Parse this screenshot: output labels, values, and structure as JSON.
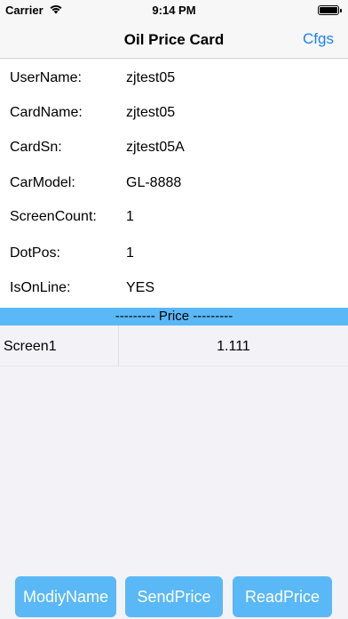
{
  "status": {
    "carrier": "Carrier",
    "time": "9:14 PM"
  },
  "nav": {
    "title": "Oil Price Card",
    "right_button": "Cfgs"
  },
  "info": [
    {
      "label": "UserName:",
      "value": "zjtest05"
    },
    {
      "label": "CardName:",
      "value": "zjtest05"
    },
    {
      "label": "CardSn:",
      "value": "zjtest05A"
    },
    {
      "label": "CarModel:",
      "value": "GL-8888"
    },
    {
      "label": "ScreenCount:",
      "value": "1"
    },
    {
      "label": "DotPos:",
      "value": "1"
    },
    {
      "label": "IsOnLine:",
      "value": "YES"
    }
  ],
  "price_header": "--------- Price ---------",
  "prices": [
    {
      "screen": "Screen1",
      "price": "1.111"
    }
  ],
  "buttons": {
    "modify": "ModiyName",
    "send": "SendPrice",
    "read": "ReadPrice"
  },
  "colors": {
    "accent": "#1a82f0",
    "button_bg": "#5ab8f6",
    "header_bg": "#5ab8f6"
  }
}
